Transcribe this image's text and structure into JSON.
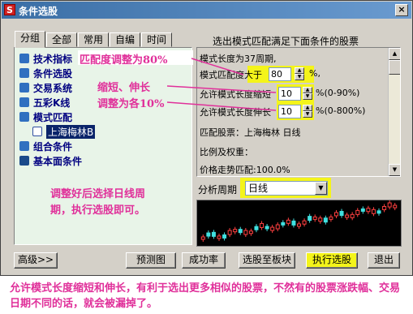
{
  "window": {
    "title": "条件选股",
    "app_icon": "S",
    "close_label": "×"
  },
  "tabs": [
    "分组",
    "全部",
    "常用",
    "自编",
    "时间"
  ],
  "tree": {
    "items": [
      "技术指标",
      "条件选股",
      "交易系统",
      "五彩K线",
      "模式匹配",
      "上海梅林B",
      "组合条件",
      "基本面条件"
    ]
  },
  "panel": {
    "header": "选出模式匹配满足下面条件的股票",
    "line1": "模式长度为37周期,",
    "match_label": "模式匹配度大于",
    "match_value": "80",
    "match_unit": "%,",
    "short_label": "允许模式长度缩短",
    "short_value": "10",
    "short_unit": "%(0-90%)",
    "long_label": "允许模式长度伸长",
    "long_value": "10",
    "long_unit": "%(0-800%)",
    "match_stock": "匹配股票：上海梅林  日线",
    "ratio_label": "比例及权重：",
    "price_match": "价格走势匹配:100.0%"
  },
  "period": {
    "label": "分析周期",
    "value": "日线"
  },
  "buttons": {
    "advanced": "高级>>",
    "preview": "预测图",
    "success_rate": "成功率",
    "select_to_block": "选股至板块",
    "execute": "执行选股",
    "exit": "退出"
  },
  "annotations": {
    "a1": "匹配度调整为80%",
    "a2_line1": "缩短、伸长",
    "a2_line2": "调整为各10%",
    "a3_line1": "调整好后选择日线周",
    "a3_line2": "期，执行选股即可。",
    "bottom": "允许模式长度缩短和伸长，有利于选出更多相似的股票，不然有的股票涨跌幅、交易日期不同的话，就会被漏掉了。"
  },
  "colors": {
    "annotation": "#e0309a",
    "highlight": "#f4f41a",
    "title_bar": "#3a6ea5"
  },
  "chart_data": {
    "type": "candlestick",
    "candles": [
      {
        "up": true
      },
      {
        "up": false
      },
      {
        "up": false
      },
      {
        "up": true
      },
      {
        "up": false
      },
      {
        "up": true
      },
      {
        "up": true
      },
      {
        "up": false
      },
      {
        "up": true
      },
      {
        "up": true
      },
      {
        "up": false
      },
      {
        "up": true
      },
      {
        "up": false
      },
      {
        "up": true
      },
      {
        "up": true
      },
      {
        "up": false
      },
      {
        "up": true
      },
      {
        "up": false
      },
      {
        "up": true
      },
      {
        "up": true
      },
      {
        "up": false
      },
      {
        "up": true
      },
      {
        "up": true
      },
      {
        "up": false
      },
      {
        "up": true
      },
      {
        "up": true
      },
      {
        "up": false
      },
      {
        "up": true
      },
      {
        "up": true
      },
      {
        "up": true
      },
      {
        "up": false
      },
      {
        "up": true
      },
      {
        "up": true
      },
      {
        "up": false
      },
      {
        "up": true
      },
      {
        "up": true
      },
      {
        "up": true
      }
    ]
  }
}
